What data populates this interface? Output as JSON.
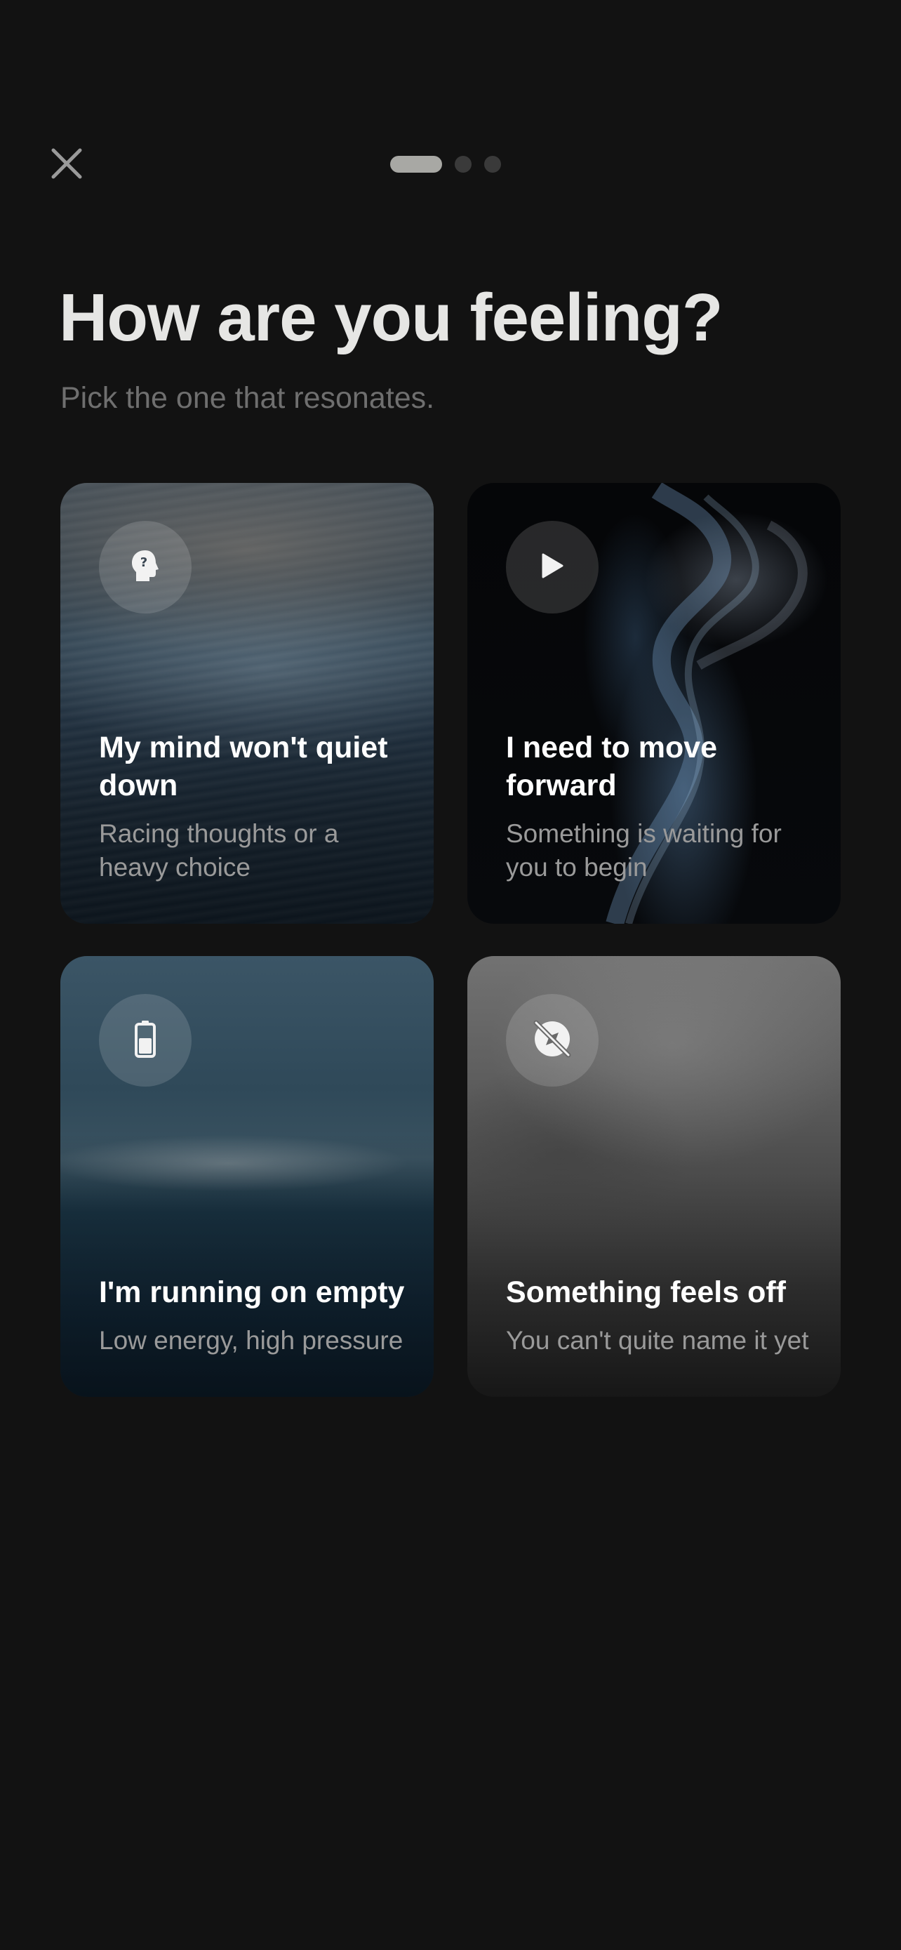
{
  "header": {
    "close_icon": "close-icon",
    "progress_steps": 3,
    "progress_current": 1
  },
  "page": {
    "title": "How are you feeling?",
    "subtitle": "Pick the one that resonates."
  },
  "cards": [
    {
      "title": "My mind won't quiet down",
      "subtitle": "Racing thoughts or a heavy choice",
      "icon": "head-question-icon"
    },
    {
      "title": "I need to move forward",
      "subtitle": "Something is waiting for you to begin",
      "icon": "play-icon"
    },
    {
      "title": "I'm running on empty",
      "subtitle": "Low energy, high pressure",
      "icon": "battery-low-icon"
    },
    {
      "title": "Something feels off",
      "subtitle": "You can't quite name it yet",
      "icon": "compass-off-icon"
    }
  ],
  "colors": {
    "background": "#121212",
    "title": "#e6e6e4",
    "subtitle": "#6f6f6f",
    "progress_active": "#a8a8a4",
    "progress_inactive": "#3a3a3a"
  }
}
